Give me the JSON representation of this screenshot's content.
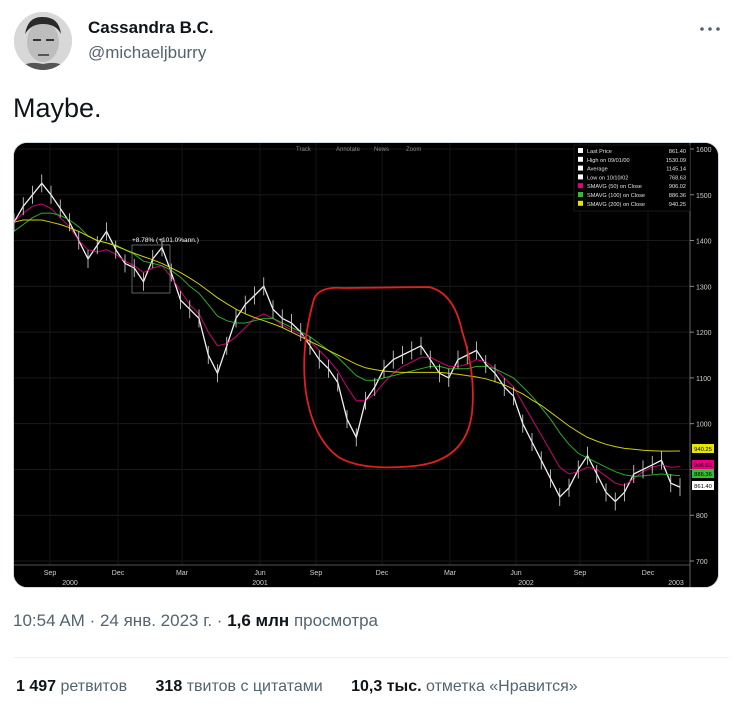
{
  "tweet": {
    "display_name": "Cassandra B.C.",
    "handle": "@michaeljburry",
    "text": "Maybe.",
    "time": "10:54 AM",
    "date": "24 янв. 2023 г.",
    "views_count": "1,6 млн",
    "views_label": "просмотра",
    "separator": "·"
  },
  "stats": {
    "retweets_count": "1 497",
    "retweets_label": "ретвитов",
    "quotes_count": "318",
    "quotes_label": "твитов с цитатами",
    "likes_count": "10,3 тыс.",
    "likes_label": "отметка «Нравится»"
  },
  "icons": {
    "more": "more-dots-icon",
    "avatar": "avatar-image"
  },
  "chart_toolbar": [
    "Track",
    "Annotate",
    "News",
    "Zoom"
  ],
  "chart_data": {
    "type": "line",
    "title": "",
    "x_ticks": [
      "Sep",
      "Dec",
      "Mar",
      "Jun",
      "Sep",
      "Dec",
      "Mar",
      "Jun",
      "Sep",
      "Dec"
    ],
    "x_years": [
      "2000",
      "2001",
      "2002",
      "2003"
    ],
    "y_ticks": [
      700,
      800,
      900,
      1000,
      1100,
      1200,
      1300,
      1400,
      1500,
      1600
    ],
    "ylim": [
      700,
      1600
    ],
    "annotation": "+8.78% (+101.0%ann.)",
    "legend": [
      {
        "label": "Last Price",
        "value": "861.40",
        "color": "#ffffff"
      },
      {
        "label": "High on 09/01/00",
        "value": "1530.09",
        "color": "#ffffff"
      },
      {
        "label": "Average",
        "value": "1145.14",
        "color": "#ffffff"
      },
      {
        "label": "Low on 10/10/02",
        "value": "768.63",
        "color": "#ffffff"
      },
      {
        "label": "SMAVG (50)  on Close",
        "value": "906.02",
        "color": "#e6007e"
      },
      {
        "label": "SMAVG (100)  on Close",
        "value": "886.36",
        "color": "#2fbf2f"
      },
      {
        "label": "SMAVG (200)  on Close",
        "value": "940.25",
        "color": "#e6e600"
      }
    ],
    "price_tags": [
      {
        "value": "940.25",
        "color": "#e6e600"
      },
      {
        "value": "906.02",
        "color": "#e6007e"
      },
      {
        "value": "886.36",
        "color": "#2fbf2f"
      },
      {
        "value": "861.40",
        "color": "#ffffff"
      }
    ],
    "series": [
      {
        "name": "Last Price",
        "color": "#ffffff",
        "values": [
          1440,
          1475,
          1500,
          1525,
          1500,
          1470,
          1440,
          1400,
          1360,
          1390,
          1420,
          1380,
          1350,
          1340,
          1310,
          1360,
          1385,
          1330,
          1270,
          1250,
          1230,
          1150,
          1110,
          1170,
          1230,
          1260,
          1280,
          1300,
          1250,
          1230,
          1220,
          1200,
          1170,
          1140,
          1120,
          1090,
          1010,
          970,
          1050,
          1080,
          1120,
          1140,
          1150,
          1160,
          1170,
          1140,
          1110,
          1100,
          1140,
          1150,
          1160,
          1130,
          1110,
          1080,
          1060,
          1000,
          960,
          920,
          880,
          840,
          860,
          900,
          930,
          890,
          850,
          830,
          850,
          890,
          900,
          910,
          920,
          870,
          861.4
        ]
      },
      {
        "name": "SMAVG (50)",
        "color": "#e6007e",
        "values": [
          1440,
          1460,
          1475,
          1480,
          1470,
          1450,
          1430,
          1400,
          1380,
          1375,
          1380,
          1370,
          1355,
          1345,
          1330,
          1340,
          1345,
          1320,
          1290,
          1260,
          1240,
          1200,
          1170,
          1175,
          1190,
          1210,
          1230,
          1240,
          1230,
          1215,
          1205,
          1195,
          1180,
          1160,
          1140,
          1115,
          1080,
          1050,
          1050,
          1065,
          1090,
          1110,
          1125,
          1135,
          1145,
          1145,
          1135,
          1125,
          1125,
          1130,
          1140,
          1135,
          1120,
          1100,
          1080,
          1045,
          1010,
          975,
          940,
          905,
          890,
          895,
          905,
          900,
          885,
          870,
          865,
          880,
          895,
          905,
          910,
          905,
          906
        ]
      },
      {
        "name": "SMAVG (100)",
        "color": "#2fbf2f",
        "values": [
          1420,
          1435,
          1450,
          1460,
          1460,
          1455,
          1445,
          1430,
          1410,
          1400,
          1395,
          1390,
          1380,
          1370,
          1355,
          1350,
          1345,
          1335,
          1320,
          1300,
          1285,
          1260,
          1235,
          1225,
          1220,
          1220,
          1225,
          1230,
          1230,
          1220,
          1210,
          1200,
          1190,
          1175,
          1160,
          1145,
          1125,
          1105,
          1095,
          1095,
          1100,
          1105,
          1110,
          1115,
          1120,
          1125,
          1125,
          1120,
          1120,
          1120,
          1125,
          1125,
          1120,
          1110,
          1100,
          1080,
          1060,
          1035,
          1010,
          980,
          955,
          935,
          925,
          915,
          905,
          895,
          888,
          885,
          886,
          888,
          890,
          888,
          886.36
        ]
      },
      {
        "name": "SMAVG (200)",
        "color": "#e6e600",
        "values": [
          1440,
          1445,
          1445,
          1445,
          1440,
          1435,
          1428,
          1420,
          1410,
          1400,
          1395,
          1388,
          1380,
          1372,
          1365,
          1358,
          1350,
          1340,
          1330,
          1318,
          1305,
          1290,
          1275,
          1262,
          1250,
          1240,
          1232,
          1225,
          1218,
          1210,
          1200,
          1190,
          1180,
          1170,
          1160,
          1150,
          1140,
          1130,
          1122,
          1118,
          1115,
          1113,
          1112,
          1112,
          1112,
          1112,
          1112,
          1110,
          1108,
          1105,
          1102,
          1098,
          1092,
          1085,
          1075,
          1065,
          1052,
          1040,
          1025,
          1010,
          995,
          982,
          970,
          962,
          955,
          950,
          946,
          944,
          942,
          941,
          940,
          940,
          940.25
        ]
      }
    ]
  }
}
